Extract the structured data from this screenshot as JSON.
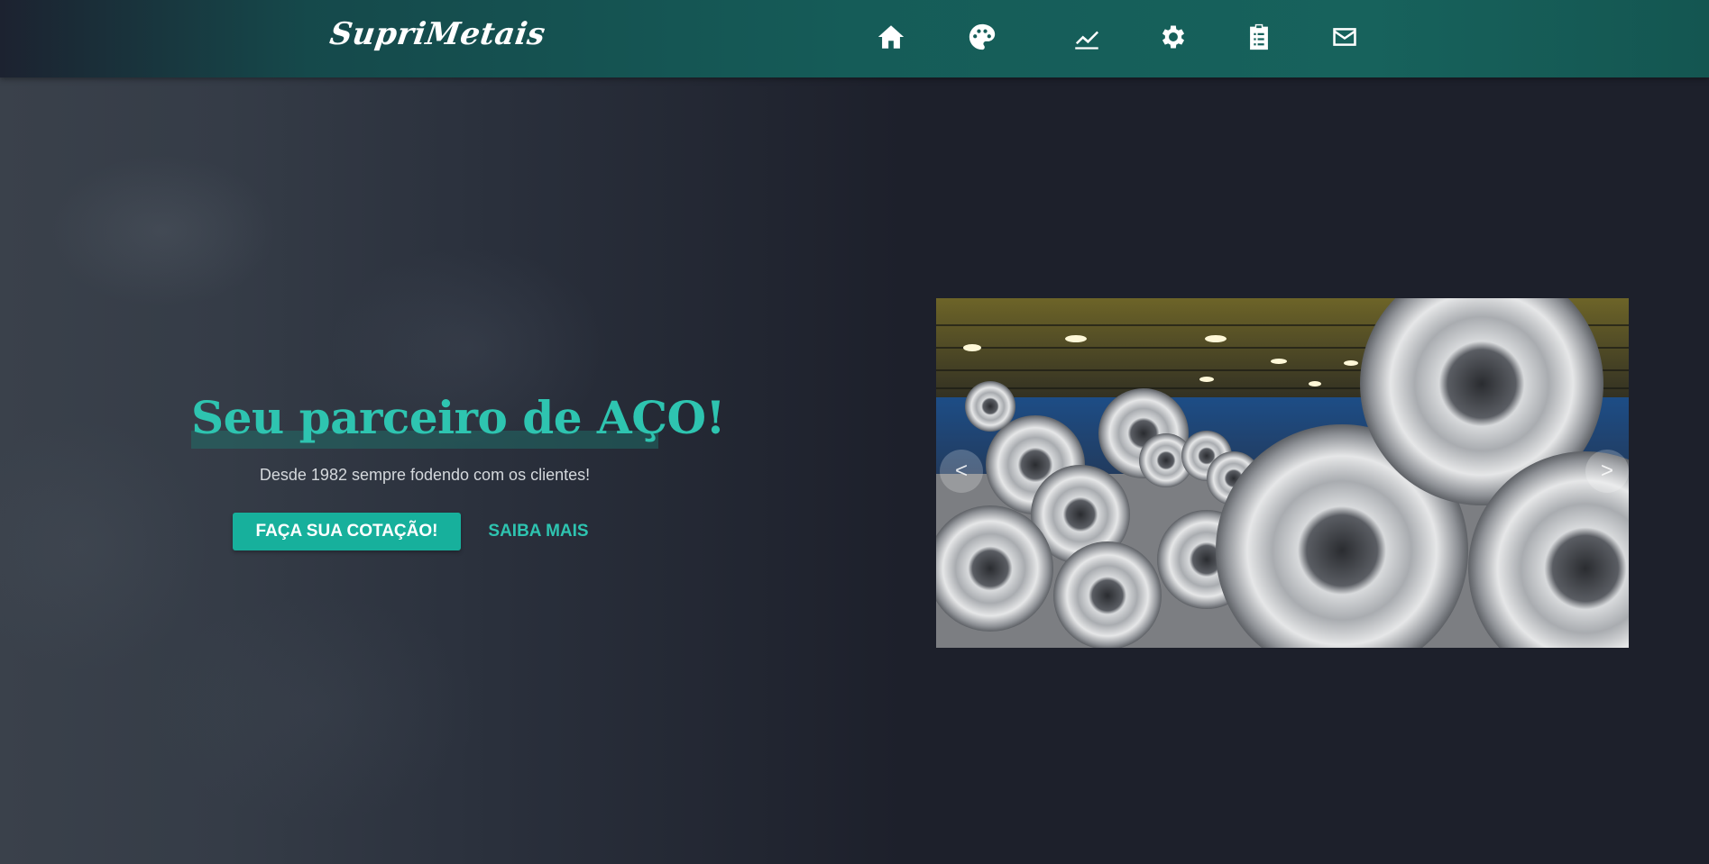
{
  "brand": {
    "name": "SupriMetais"
  },
  "nav": {
    "items": [
      {
        "icon": "home-icon"
      },
      {
        "icon": "palette-icon"
      },
      {
        "icon": "chart-line-icon"
      },
      {
        "icon": "gear-icon"
      },
      {
        "icon": "clipboard-list-icon"
      },
      {
        "icon": "mail-icon"
      }
    ]
  },
  "hero": {
    "headline": "Seu parceiro de AÇO!",
    "subtitle": "Desde 1982 sempre fodendo com os clientes!",
    "primary_button": "FAÇA SUA COTAÇÃO!",
    "secondary_button": "SAIBA MAIS"
  },
  "carousel": {
    "image": "steel-coils-warehouse-photo",
    "prev_label": "<",
    "next_label": ">"
  },
  "colors": {
    "accent": "#2ec4b0",
    "button": "#17b09c",
    "navbar": "#155c58",
    "background": "#1d202b"
  }
}
